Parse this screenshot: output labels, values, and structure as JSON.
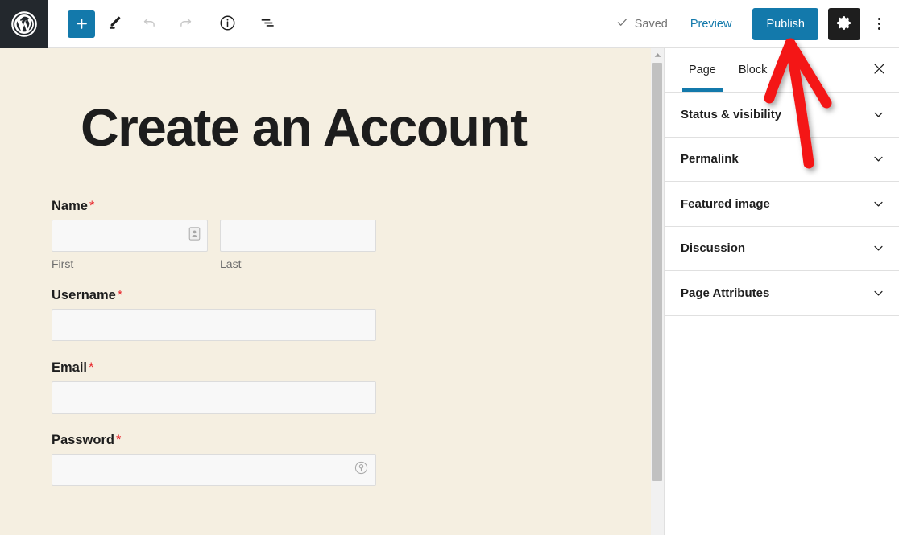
{
  "colors": {
    "accent_blue": "#1379ab",
    "canvas_bg": "#f5efe1",
    "dark": "#1e1e1e",
    "wp_logo_bg": "#23282d",
    "required_red": "#e8282d",
    "annotation_red": "#f41414",
    "input_bg": "#f8f8f8",
    "input_border": "#dcdcdc",
    "divider": "#e0e0e0"
  },
  "toolbar": {
    "logo_icon": "wordpress-logo-icon",
    "add_block_icon": "plus-icon",
    "add_block_label": "Add block",
    "edit_icon": "pencil-icon",
    "edit_label": "Tools",
    "undo_icon": "undo-arrow-icon",
    "undo_label": "Undo",
    "redo_icon": "redo-arrow-icon",
    "redo_label": "Redo",
    "info_icon": "info-circle-icon",
    "info_label": "Details",
    "listview_icon": "list-view-icon",
    "listview_label": "List view",
    "saved_icon": "checkmark-icon",
    "saved_label": "Saved",
    "preview_label": "Preview",
    "publish_label": "Publish",
    "settings_icon": "gear-icon",
    "settings_label": "Settings",
    "more_icon": "three-dots-vertical-icon",
    "more_label": "Options"
  },
  "canvas": {
    "post_title": "Create an Account",
    "scrollbar": {
      "up_arrow_icon": "scroll-up-arrow-icon"
    },
    "form": {
      "fields": [
        {
          "label": "Name",
          "required_marker": "*",
          "type": "name",
          "parts": [
            {
              "sublabel": "First",
              "value": "",
              "icon": "contact-card-autofill-icon"
            },
            {
              "sublabel": "Last",
              "value": "",
              "icon": ""
            }
          ]
        },
        {
          "label": "Username",
          "required_marker": "*",
          "type": "text",
          "value": "",
          "icon": ""
        },
        {
          "label": "Email",
          "required_marker": "*",
          "type": "email",
          "value": "",
          "icon": ""
        },
        {
          "label": "Password",
          "required_marker": "*",
          "type": "password",
          "value": "",
          "icon": "password-key-icon"
        }
      ]
    }
  },
  "sidebar": {
    "tabs": [
      {
        "label": "Page",
        "active": true
      },
      {
        "label": "Block",
        "active": false
      }
    ],
    "close_icon": "close-x-icon",
    "close_label": "Close settings",
    "panels": [
      {
        "label": "Status & visibility",
        "icon": "chevron-down-icon"
      },
      {
        "label": "Permalink",
        "icon": "chevron-down-icon"
      },
      {
        "label": "Featured image",
        "icon": "chevron-down-icon"
      },
      {
        "label": "Discussion",
        "icon": "chevron-down-icon"
      },
      {
        "label": "Page Attributes",
        "icon": "chevron-down-icon"
      }
    ]
  },
  "annotation": {
    "type": "arrow",
    "points_to": "publish-button",
    "color": "#f41414"
  }
}
